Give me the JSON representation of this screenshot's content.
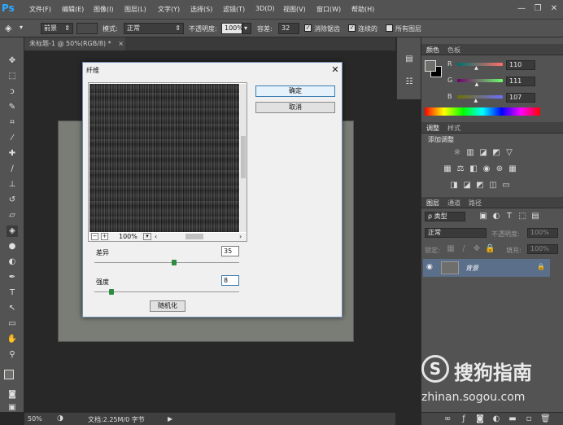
{
  "app": {
    "logo": "Ps",
    "menu": [
      "文件(F)",
      "编辑(E)",
      "图像(I)",
      "图层(L)",
      "文字(Y)",
      "选择(S)",
      "滤镜(T)",
      "3D(D)",
      "视图(V)",
      "窗口(W)",
      "帮助(H)"
    ],
    "window_controls": [
      "minimize-icon",
      "restore-icon",
      "close-icon"
    ]
  },
  "options_bar": {
    "tool_icon": "paint-bucket-icon",
    "fill_source": "前景",
    "mode_label": "模式:",
    "mode_value": "正常",
    "opacity_label": "不透明度:",
    "opacity_value": "100%",
    "tolerance_label": "容差:",
    "tolerance_value": "32",
    "antialias_label": "消除锯齿",
    "antialias_checked": true,
    "contiguous_label": "连续的",
    "contiguous_checked": true,
    "all_layers_label": "所有图层",
    "all_layers_checked": false
  },
  "document_tab": {
    "label": "未标题-1 @ 50%(RGB/8) *",
    "close": "×"
  },
  "status_bar": {
    "zoom": "50%",
    "doc_info": "文档:2.25M/0 字节"
  },
  "tools": [
    "move-icon",
    "marquee-icon",
    "lasso-icon",
    "quick-select-icon",
    "crop-icon",
    "eyedropper-icon",
    "healing-brush-icon",
    "brush-icon",
    "clone-stamp-icon",
    "history-brush-icon",
    "eraser-icon",
    "paint-bucket-icon",
    "blur-icon",
    "dodge-icon",
    "pen-icon",
    "type-icon",
    "path-select-icon",
    "rectangle-icon",
    "hand-icon",
    "zoom-icon",
    "foreground-background-icon",
    "quick-mask-icon",
    "screen-mode-icon"
  ],
  "color_panel": {
    "tabs": [
      "颜色",
      "色板"
    ],
    "channels": [
      {
        "label": "R",
        "value": "110",
        "level": 0.43
      },
      {
        "label": "G",
        "value": "111",
        "level": 0.44
      },
      {
        "label": "B",
        "value": "107",
        "level": 0.42
      }
    ],
    "foreground_color": "#6e6f6b",
    "background_color": "#000000"
  },
  "adjustments_panel": {
    "tabs": [
      "调整",
      "样式"
    ],
    "title": "添加调整",
    "icons": [
      "brightness-icon",
      "levels-icon",
      "curves-icon",
      "exposure-icon",
      "vibrance-icon",
      "hue-saturation-icon",
      "color-balance-icon",
      "black-white-icon",
      "photo-filter-icon",
      "channel-mixer-icon",
      "color-lookup-icon",
      "invert-icon",
      "posterize-icon",
      "threshold-icon",
      "selective-color-icon",
      "gradient-map-icon"
    ]
  },
  "layers_panel": {
    "tabs": [
      "图层",
      "通道",
      "路径"
    ],
    "filter_label": "ρ 类型",
    "blend_mode": "正常",
    "opacity_label": "不透明度:",
    "opacity_value": "100%",
    "lock_label": "锁定:",
    "fill_label": "填充:",
    "fill_value": "100%",
    "layer_name": "背景"
  },
  "dialog": {
    "title": "纤维",
    "close": "✕",
    "ok_label": "确定",
    "cancel_label": "取消",
    "zoom_value": "100%",
    "variance_label": "差异",
    "variance_value": "35",
    "variance_level": 0.55,
    "strength_label": "强度",
    "strength_value": "8",
    "strength_level": 0.12,
    "randomize_label": "随机化"
  },
  "watermark": {
    "brand": "搜狗指南",
    "url": "zhinan.sogou.com"
  }
}
